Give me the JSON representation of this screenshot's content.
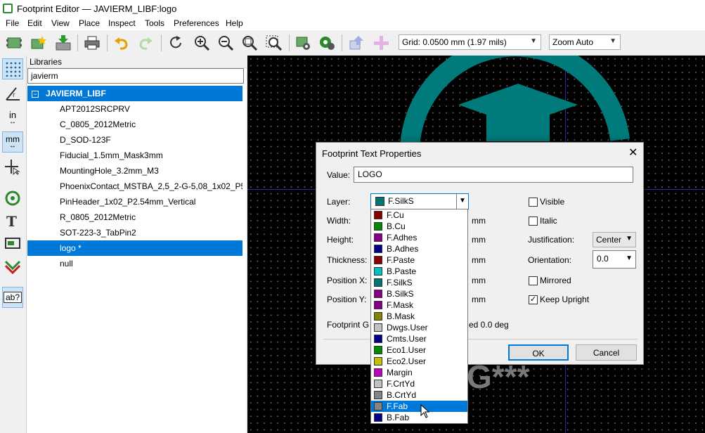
{
  "window": {
    "title": "Footprint Editor — JAVIERM_LIBF:logo"
  },
  "menubar": [
    "File",
    "Edit",
    "View",
    "Place",
    "Inspect",
    "Tools",
    "Preferences",
    "Help"
  ],
  "toolbar": {
    "grid": "Grid: 0.0500 mm (1.97 mils)",
    "zoom": "Zoom Auto"
  },
  "lefttools": {
    "in": "in",
    "mm": "mm",
    "text": "ab?"
  },
  "libraries": {
    "header": "Libraries",
    "search": "javierm",
    "root": {
      "toggle": "−",
      "name": "JAVIERM_LIBF"
    },
    "items": [
      "APT2012SRCPRV",
      "C_0805_2012Metric",
      "D_SOD-123F",
      "Fiducial_1.5mm_Mask3mm",
      "MountingHole_3.2mm_M3",
      "PhoenixContact_MSTBA_2,5_2-G-5,08_1x02_P5.08",
      "PinHeader_1x02_P2.54mm_Vertical",
      "R_0805_2012Metric",
      "SOT-223-3_TabPin2",
      "logo *",
      "null"
    ]
  },
  "canvas": {
    "bg_text": "G***"
  },
  "dialog": {
    "title": "Footprint Text Properties",
    "value_label": "Value:",
    "value": "LOGO",
    "layer_label": "Layer:",
    "layer": "F.SilkS",
    "layer_color": "#007575",
    "width_label": "Width:",
    "height_label": "Height:",
    "thickness_label": "Thickness:",
    "posx_label": "Position X:",
    "posy_label": "Position Y:",
    "units": [
      "mm",
      "mm",
      "mm",
      "mm",
      "mm"
    ],
    "footprint_label": "Footprint G",
    "rotated_text": "ed 0.0 deg",
    "visible": "Visible",
    "italic": "Italic",
    "justification_label": "Justification:",
    "justification": "Center",
    "orientation_label": "Orientation:",
    "orientation": "0.0",
    "mirrored": "Mirrored",
    "keep_upright": "Keep Upright",
    "ok": "OK",
    "cancel": "Cancel"
  },
  "layers": [
    {
      "name": "F.Cu",
      "color": "#8b0000"
    },
    {
      "name": "B.Cu",
      "color": "#008b00"
    },
    {
      "name": "F.Adhes",
      "color": "#8b008b"
    },
    {
      "name": "B.Adhes",
      "color": "#00008b"
    },
    {
      "name": "F.Paste",
      "color": "#8b0000"
    },
    {
      "name": "B.Paste",
      "color": "#00c2c2"
    },
    {
      "name": "F.SilkS",
      "color": "#007575"
    },
    {
      "name": "B.SilkS",
      "color": "#8b008b"
    },
    {
      "name": "F.Mask",
      "color": "#8b008b"
    },
    {
      "name": "B.Mask",
      "color": "#848400"
    },
    {
      "name": "Dwgs.User",
      "color": "#c2c2c2"
    },
    {
      "name": "Cmts.User",
      "color": "#00008b"
    },
    {
      "name": "Eco1.User",
      "color": "#008b00"
    },
    {
      "name": "Eco2.User",
      "color": "#c2c200"
    },
    {
      "name": "Margin",
      "color": "#c200c2"
    },
    {
      "name": "F.CrtYd",
      "color": "#c2c2c2"
    },
    {
      "name": "B.CrtYd",
      "color": "#848484"
    },
    {
      "name": "F.Fab",
      "color": "#848484"
    },
    {
      "name": "B.Fab",
      "color": "#00008b"
    }
  ]
}
